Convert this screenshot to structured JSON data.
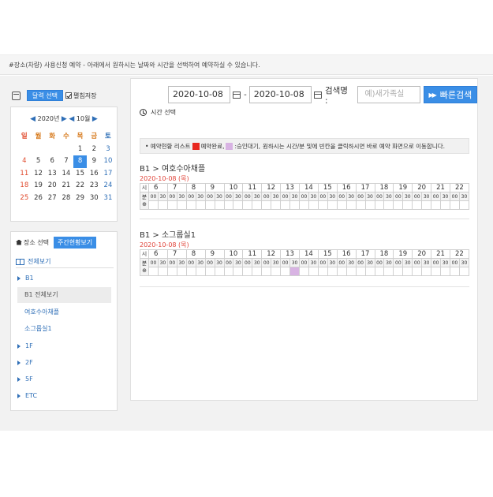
{
  "notice": "#장소(차량) 사용신청 예약 - 아래에서 원하시는 날짜와 시간을 선택하여 예약하실 수 있습니다.",
  "left": {
    "calendar_button": "달력 선택",
    "remember_label": "펼침저장",
    "year": "2020년",
    "month": "10월",
    "weekdays": [
      "일",
      "월",
      "화",
      "수",
      "목",
      "금",
      "토"
    ],
    "weeks": [
      [
        "",
        "",
        "",
        "",
        "1",
        "2",
        "3"
      ],
      [
        "4",
        "5",
        "6",
        "7",
        "8",
        "9",
        "10"
      ],
      [
        "11",
        "12",
        "13",
        "14",
        "15",
        "16",
        "17"
      ],
      [
        "18",
        "19",
        "20",
        "21",
        "22",
        "23",
        "24"
      ],
      [
        "25",
        "26",
        "27",
        "28",
        "29",
        "30",
        "31"
      ]
    ],
    "today": "8",
    "place_tab": "장소 선택",
    "weekly_tab": "주간현황보기",
    "all_view": "전체보기",
    "tree": {
      "b1": "B1",
      "b1_all": "B1 전체보기",
      "room1": "여호수아채플",
      "room2": "소그룹실1",
      "f1": "1F",
      "f2": "2F",
      "f5": "5F",
      "etc": "ETC"
    }
  },
  "search": {
    "date_from": "2020-10-08",
    "date_to": "2020-10-08",
    "dash": "-",
    "keyword_label": "검색명 :",
    "keyword_placeholder": "예)새가족실",
    "quick_search": "빠른검색",
    "time_select": "시간 선택"
  },
  "legend": {
    "prefix": "• 예약현황 리스트",
    "done_label": "예약완료,",
    "pending_label": ":승인대기,",
    "help": "원하시는 시간/분 및에 빈칸을 클릭하시면 바로 예약 화면으로 이동합니다.",
    "done_color": "#e8271e",
    "pending_color": "#d8b3e3"
  },
  "rooms": [
    {
      "title": "B1 > 여호수아채플",
      "date": "2020-10-08 (목)",
      "hour_label": "시",
      "min_label": "분",
      "hours": [
        "6",
        "7",
        "8",
        "9",
        "10",
        "11",
        "12",
        "13",
        "14",
        "15",
        "16",
        "17",
        "18",
        "19",
        "20",
        "21",
        "22"
      ],
      "pending_slots": []
    },
    {
      "title": "B1 > 소그룹실1",
      "date": "2020-10-08 (목)",
      "hour_label": "시",
      "min_label": "분",
      "hours": [
        "6",
        "7",
        "8",
        "9",
        "10",
        "11",
        "12",
        "13",
        "14",
        "15",
        "16",
        "17",
        "18",
        "19",
        "20",
        "21",
        "22"
      ],
      "pending_slots": [
        15
      ]
    }
  ],
  "minute_labels": [
    "00",
    "30"
  ]
}
